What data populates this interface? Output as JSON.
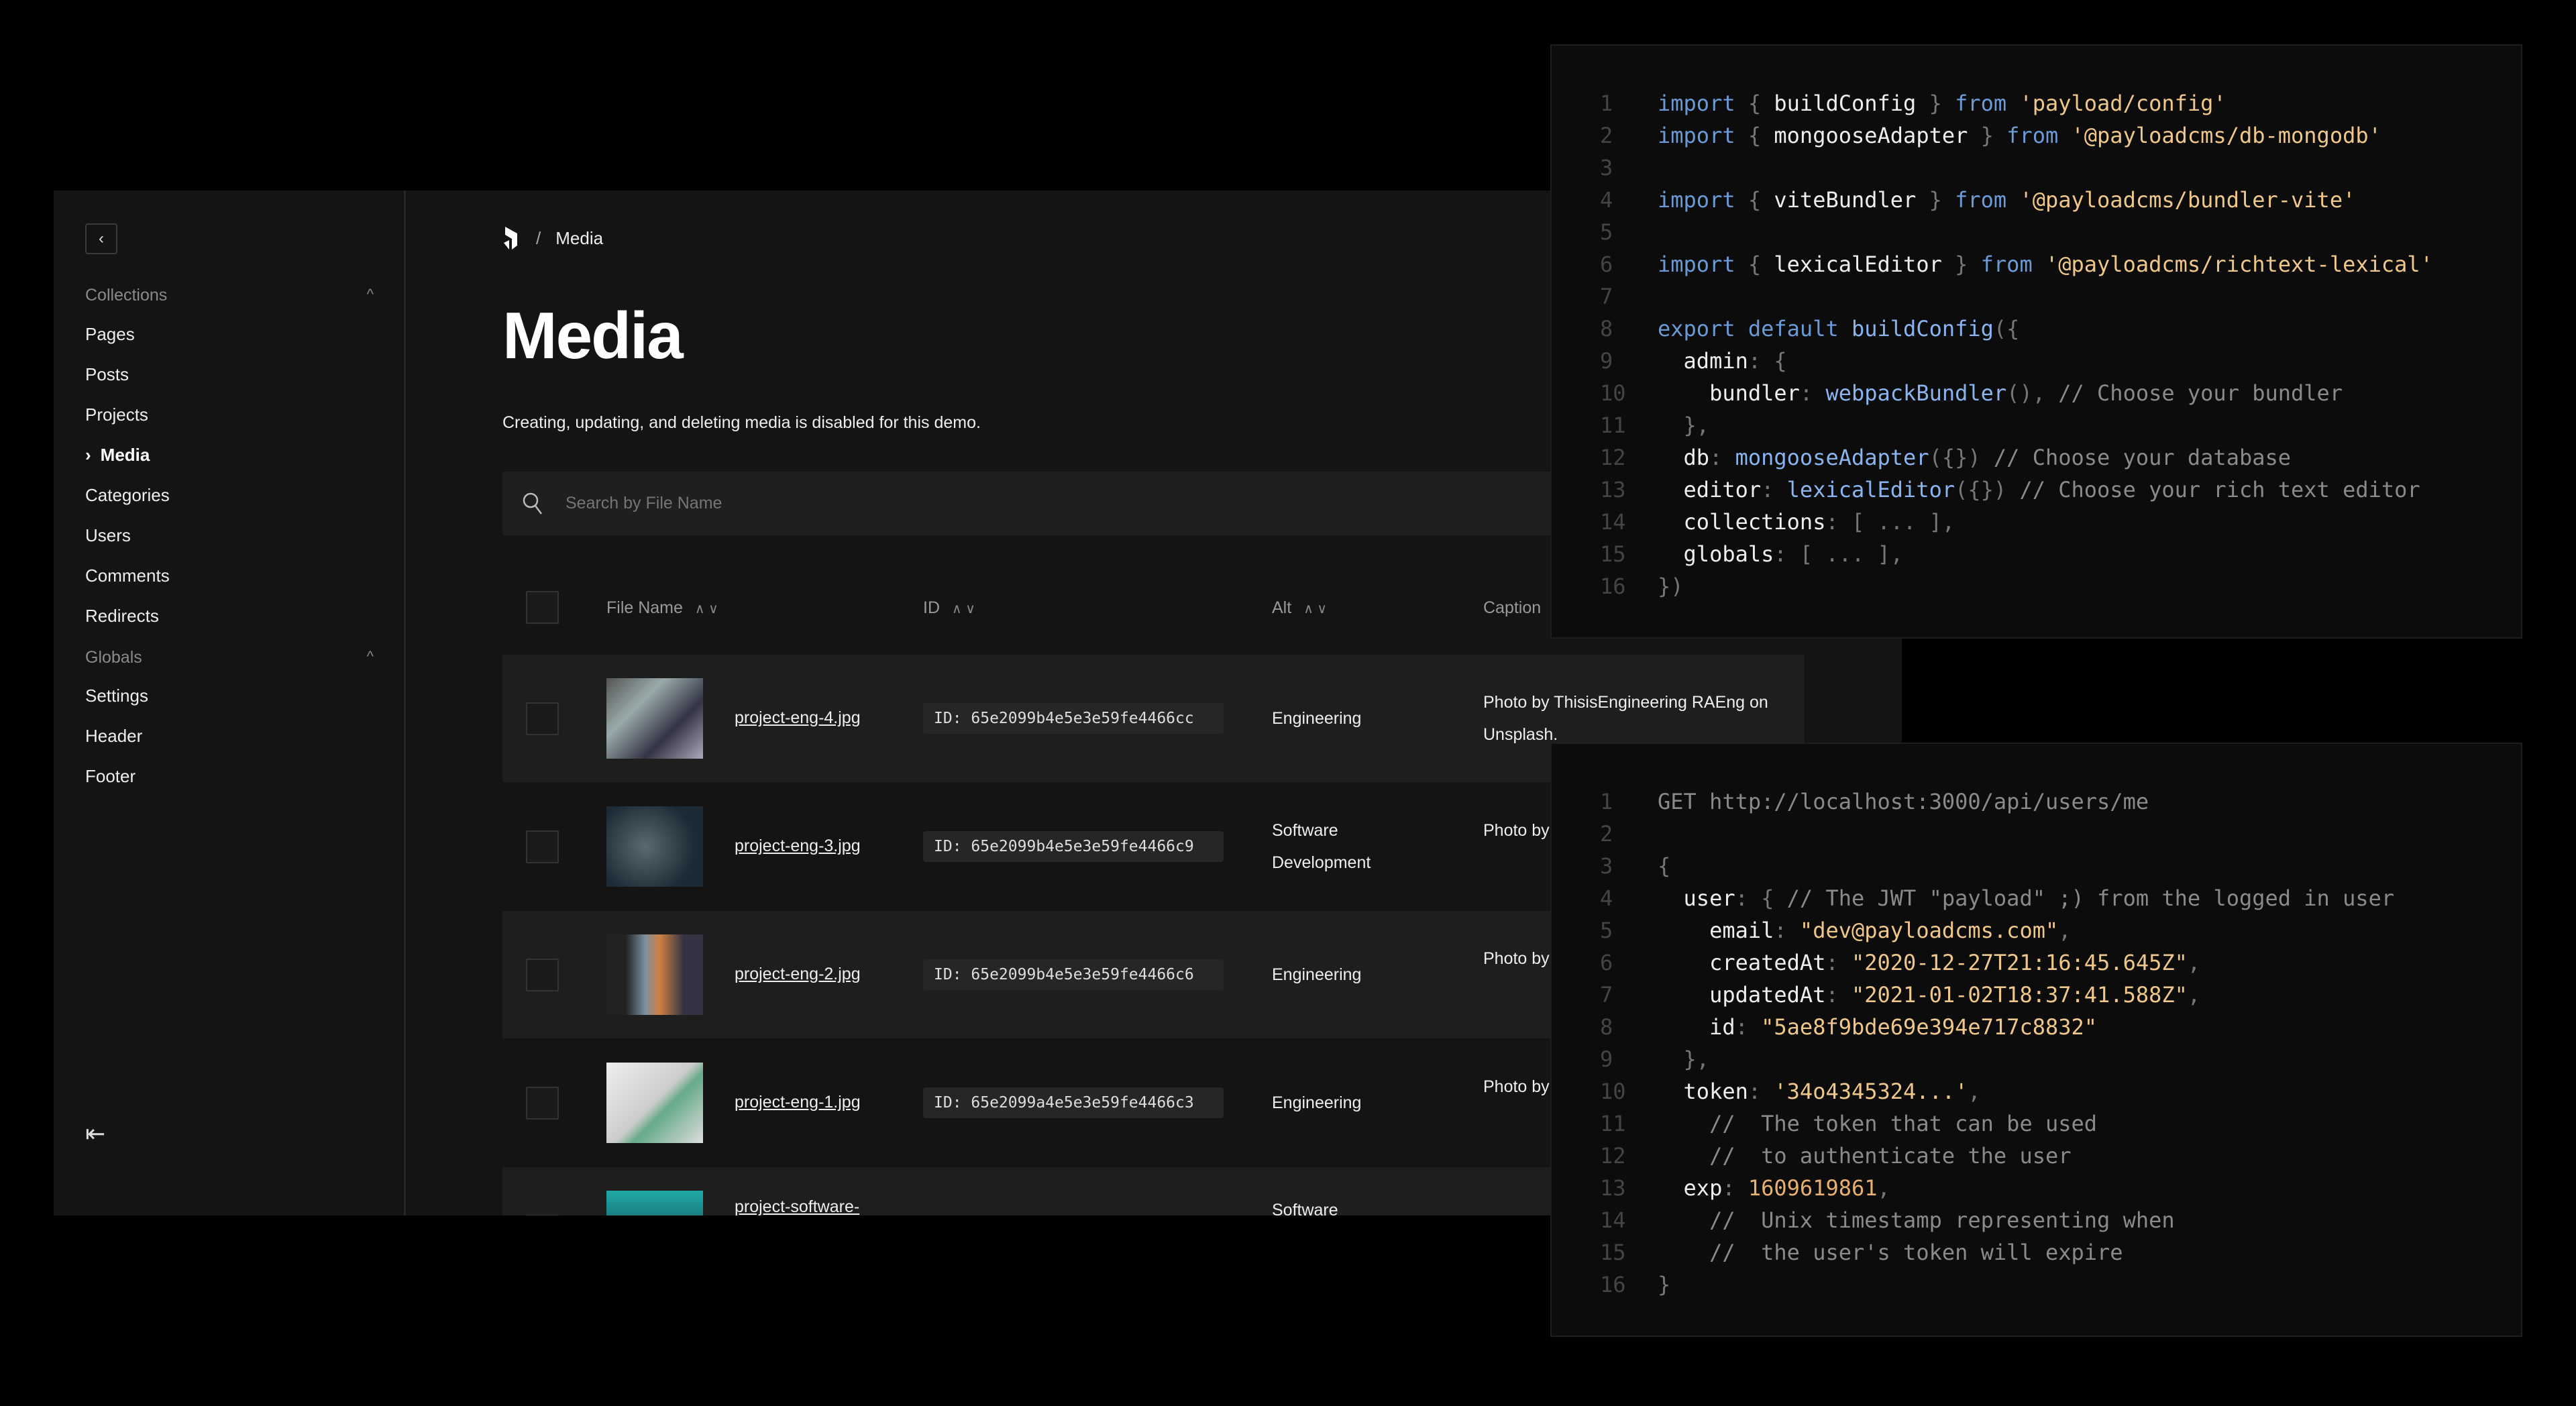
{
  "sidebar": {
    "back_icon": "chevron-left-icon",
    "collections_label": "Collections",
    "collections": [
      "Pages",
      "Posts",
      "Projects",
      "Media",
      "Categories",
      "Users",
      "Comments",
      "Redirects"
    ],
    "active": "Media",
    "globals_label": "Globals",
    "globals": [
      "Settings",
      "Header",
      "Footer"
    ],
    "logout_icon": "logout-icon"
  },
  "breadcrumb": {
    "sep": "/",
    "current": "Media"
  },
  "page": {
    "title": "Media",
    "description": "Creating, updating, and deleting media is disabled for this demo.",
    "search_placeholder": "Search by File Name"
  },
  "table": {
    "columns": [
      "File Name",
      "ID",
      "Alt",
      "Caption"
    ],
    "rows": [
      {
        "file": "project-eng-4.jpg",
        "id": "ID: 65e2099b4e5e3e59fe4466cc",
        "alt": "Engineering",
        "caption": "Photo by ThisisEngineering RAEng on Unsplash."
      },
      {
        "file": "project-eng-3.jpg",
        "id": "ID: 65e2099b4e5e3e59fe4466c9",
        "alt": "Software Development",
        "caption": "Photo by Unsplash"
      },
      {
        "file": "project-eng-2.jpg",
        "id": "ID: 65e2099b4e5e3e59fe4466c6",
        "alt": "Engineering",
        "caption": "Photo by Unsplash"
      },
      {
        "file": "project-eng-1.jpg",
        "id": "ID: 65e2099a4e5e3e59fe4466c3",
        "alt": "Engineering",
        "caption": "Photo by Unsplash"
      },
      {
        "file": "project-software-",
        "id": "",
        "alt": "Software",
        "caption": ""
      }
    ]
  },
  "code1": [
    [
      [
        "k",
        "import"
      ],
      [
        "p",
        " { "
      ],
      [
        "",
        "buildConfig"
      ],
      [
        "p",
        " } "
      ],
      [
        "k",
        "from"
      ],
      [
        "s",
        " 'payload/config'"
      ]
    ],
    [
      [
        "k",
        "import"
      ],
      [
        "p",
        " { "
      ],
      [
        "",
        "mongooseAdapter"
      ],
      [
        "p",
        " } "
      ],
      [
        "k",
        "from"
      ],
      [
        "s",
        " '@payloadcms/db-mongodb'"
      ]
    ],
    [],
    [
      [
        "k",
        "import"
      ],
      [
        "p",
        " { "
      ],
      [
        "",
        "viteBundler"
      ],
      [
        "p",
        " } "
      ],
      [
        "k",
        "from"
      ],
      [
        "s",
        " '@payloadcms/bundler-vite'"
      ]
    ],
    [],
    [
      [
        "k",
        "import"
      ],
      [
        "p",
        " { "
      ],
      [
        "",
        "lexicalEditor"
      ],
      [
        "p",
        " } "
      ],
      [
        "k",
        "from"
      ],
      [
        "s",
        " '@payloadcms/richtext-lexical'"
      ]
    ],
    [],
    [
      [
        "k",
        "export default "
      ],
      [
        "f",
        "buildConfig"
      ],
      [
        "p",
        "({"
      ]
    ],
    [
      [
        "",
        "  admin"
      ],
      [
        "p",
        ": {"
      ]
    ],
    [
      [
        "",
        "    bundler"
      ],
      [
        "p",
        ": "
      ],
      [
        "f",
        "webpackBundler"
      ],
      [
        "p",
        "(), "
      ],
      [
        "cm",
        "// Choose your bundler"
      ]
    ],
    [
      [
        "p",
        "  },"
      ]
    ],
    [
      [
        "",
        "  db"
      ],
      [
        "p",
        ": "
      ],
      [
        "f",
        "mongooseAdapter"
      ],
      [
        "p",
        "({}) "
      ],
      [
        "cm",
        "// Choose your database"
      ]
    ],
    [
      [
        "",
        "  editor"
      ],
      [
        "p",
        ": "
      ],
      [
        "f",
        "lexicalEditor"
      ],
      [
        "p",
        "({}) "
      ],
      [
        "cm",
        "// Choose your rich text editor"
      ]
    ],
    [
      [
        "",
        "  collections"
      ],
      [
        "p",
        ": [ ... ],"
      ]
    ],
    [
      [
        "",
        "  globals"
      ],
      [
        "p",
        ": [ ... ],"
      ]
    ],
    [
      [
        "p",
        "})"
      ]
    ]
  ],
  "code2": [
    [
      [
        "cm",
        "GET http://localhost:3000/api/users/me"
      ]
    ],
    [],
    [
      [
        "p",
        "{"
      ]
    ],
    [
      [
        "",
        "  user"
      ],
      [
        "p",
        ": { "
      ],
      [
        "cm",
        "// The JWT \"payload\" ;) from the logged in user"
      ]
    ],
    [
      [
        "",
        "    email"
      ],
      [
        "p",
        ": "
      ],
      [
        "s",
        "\"dev@payloadcms.com\""
      ],
      [
        "p",
        ","
      ]
    ],
    [
      [
        "",
        "    createdAt"
      ],
      [
        "p",
        ": "
      ],
      [
        "s",
        "\"2020-12-27T21:16:45.645Z\""
      ],
      [
        "p",
        ","
      ]
    ],
    [
      [
        "",
        "    updatedAt"
      ],
      [
        "p",
        ": "
      ],
      [
        "s",
        "\"2021-01-02T18:37:41.588Z\""
      ],
      [
        "p",
        ","
      ]
    ],
    [
      [
        "",
        "    id"
      ],
      [
        "p",
        ": "
      ],
      [
        "s",
        "\"5ae8f9bde69e394e717c8832\""
      ]
    ],
    [
      [
        "p",
        "  },"
      ]
    ],
    [
      [
        "",
        "  token"
      ],
      [
        "p",
        ": "
      ],
      [
        "s",
        "'34o4345324...'"
      ],
      [
        "p",
        ","
      ]
    ],
    [
      [
        "cm",
        "    //  The token that can be used"
      ]
    ],
    [
      [
        "cm",
        "    //  to authenticate the user"
      ]
    ],
    [
      [
        "",
        "  exp"
      ],
      [
        "p",
        ": "
      ],
      [
        "nm",
        "1609619861"
      ],
      [
        "p",
        ","
      ]
    ],
    [
      [
        "cm",
        "    //  Unix timestamp representing when"
      ]
    ],
    [
      [
        "cm",
        "    //  the user's token will expire"
      ]
    ],
    [
      [
        "p",
        "}"
      ]
    ]
  ]
}
